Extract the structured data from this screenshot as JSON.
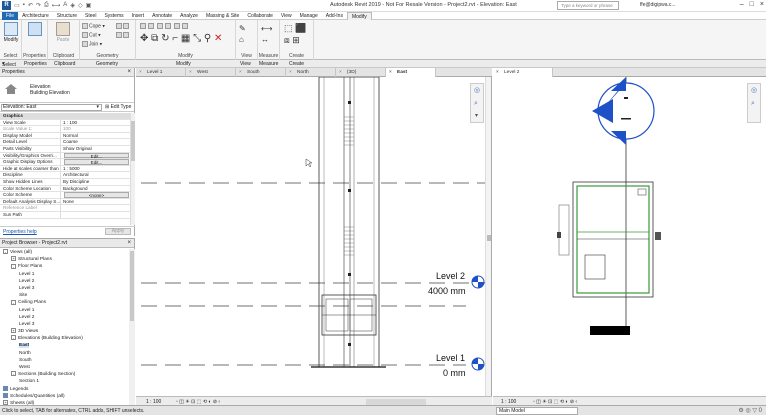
{
  "titlebar": {
    "app_icon": "R",
    "title": "Autodesk Revit 2019 - Not For Resale Version - Project2.rvt - Elevation: East",
    "search_placeholder": "Type a keyword or phrase",
    "user": "ffe@digipwa.c...",
    "qat_icons": [
      "open-icon",
      "save-icon",
      "undo-icon",
      "redo-icon",
      "print-icon",
      "measure-icon",
      "text-icon",
      "3d-icon",
      "section-icon",
      "window-icon"
    ]
  },
  "tabs": [
    "File",
    "Architecture",
    "Structure",
    "Steel",
    "Systems",
    "Insert",
    "Annotate",
    "Analyze",
    "Massing & Site",
    "Collaborate",
    "View",
    "Manage",
    "Add-Ins",
    "Modify"
  ],
  "ribbon": {
    "select": {
      "modify_label": "Modify"
    },
    "properties": {
      "label": "Properties"
    },
    "clipboard": {
      "paste_label": "Paste",
      "cope_label": "Cope",
      "cut_label": "Cut",
      "join_label": "Join"
    },
    "groups": [
      "Select",
      "Properties",
      "Clipboard",
      "Geometry",
      "Modify",
      "View",
      "Measure",
      "Create"
    ]
  },
  "properties": {
    "title": "Properties",
    "type_line1": "Elevation",
    "type_line2": "Building Elevation",
    "instance": "Elevation: East",
    "edit_type": "Edit Type",
    "rows": [
      {
        "k": "Graphics",
        "v": "",
        "type": "cat"
      },
      {
        "k": "View Scale",
        "v": "1 : 100"
      },
      {
        "k": "Scale Value    1:",
        "v": "100",
        "type": "dim"
      },
      {
        "k": "Display Model",
        "v": "Normal"
      },
      {
        "k": "Detail Level",
        "v": "Coarse"
      },
      {
        "k": "Parts Visibility",
        "v": "Show Original"
      },
      {
        "k": "Visibility/Graphics Overri...",
        "v": "Edit...",
        "type": "btn"
      },
      {
        "k": "Graphic Display Options",
        "v": "Edit...",
        "type": "btn"
      },
      {
        "k": "Hide at scales coarser than",
        "v": "1 : 5000"
      },
      {
        "k": "Discipline",
        "v": "Architectural"
      },
      {
        "k": "Show Hidden Lines",
        "v": "By Discipline"
      },
      {
        "k": "Color Scheme Location",
        "v": "Background"
      },
      {
        "k": "Color Scheme",
        "v": "<none>",
        "type": "btn"
      },
      {
        "k": "Default Analysis Display S...",
        "v": "None"
      },
      {
        "k": "Reference Label",
        "v": "",
        "type": "dim"
      },
      {
        "k": "Sun Path",
        "v": ""
      }
    ],
    "help_link": "Properties help",
    "apply": "Apply"
  },
  "browser": {
    "title": "Project Browser - Project2.rvt",
    "nodes": [
      {
        "label": "Views (all)",
        "level": 0,
        "toggle": "-"
      },
      {
        "label": "Structural Plans",
        "level": 1,
        "toggle": "+"
      },
      {
        "label": "Floor Plans",
        "level": 1,
        "toggle": "-"
      },
      {
        "label": "Level 1",
        "level": 2
      },
      {
        "label": "Level 2",
        "level": 2
      },
      {
        "label": "Level 3",
        "level": 2
      },
      {
        "label": "Site",
        "level": 2
      },
      {
        "label": "Ceiling Plans",
        "level": 1,
        "toggle": "-"
      },
      {
        "label": "Level 1",
        "level": 2
      },
      {
        "label": "Level 2",
        "level": 2
      },
      {
        "label": "Level 3",
        "level": 2
      },
      {
        "label": "3D Views",
        "level": 1,
        "toggle": "+"
      },
      {
        "label": "Elevations (Building Elevation)",
        "level": 1,
        "toggle": "-"
      },
      {
        "label": "East",
        "level": 2,
        "selected": true
      },
      {
        "label": "North",
        "level": 2
      },
      {
        "label": "South",
        "level": 2
      },
      {
        "label": "West",
        "level": 2
      },
      {
        "label": "Sections (Building Section)",
        "level": 1,
        "toggle": "-"
      },
      {
        "label": "Section 1",
        "level": 2
      },
      {
        "label": "Legends",
        "level": 0
      },
      {
        "label": "Schedules/Quantities (all)",
        "level": 0
      },
      {
        "label": "Sheets (all)",
        "level": 0,
        "toggle": "+"
      }
    ]
  },
  "view_tabs": [
    "Level 1",
    "West",
    "South",
    "North",
    "{3D}",
    "East"
  ],
  "active_view": "East",
  "view2_tab": "Level 2",
  "levels": [
    {
      "name": "Level 2",
      "elevation": "4000 mm"
    },
    {
      "name": "Level 1",
      "elevation": "0 mm"
    }
  ],
  "view_scale": "1 : 100",
  "statusbar": {
    "message": "Click to select, TAB for alternates, CTRL adds, SHIFT unselects.",
    "model": "Main Model",
    "right_icons": "⚙ ◎ ▽ 0"
  },
  "colors": {
    "file_tab": "#1f6ab5",
    "level_head": "#1e50c8",
    "accent_green": "#3a9a3a"
  }
}
